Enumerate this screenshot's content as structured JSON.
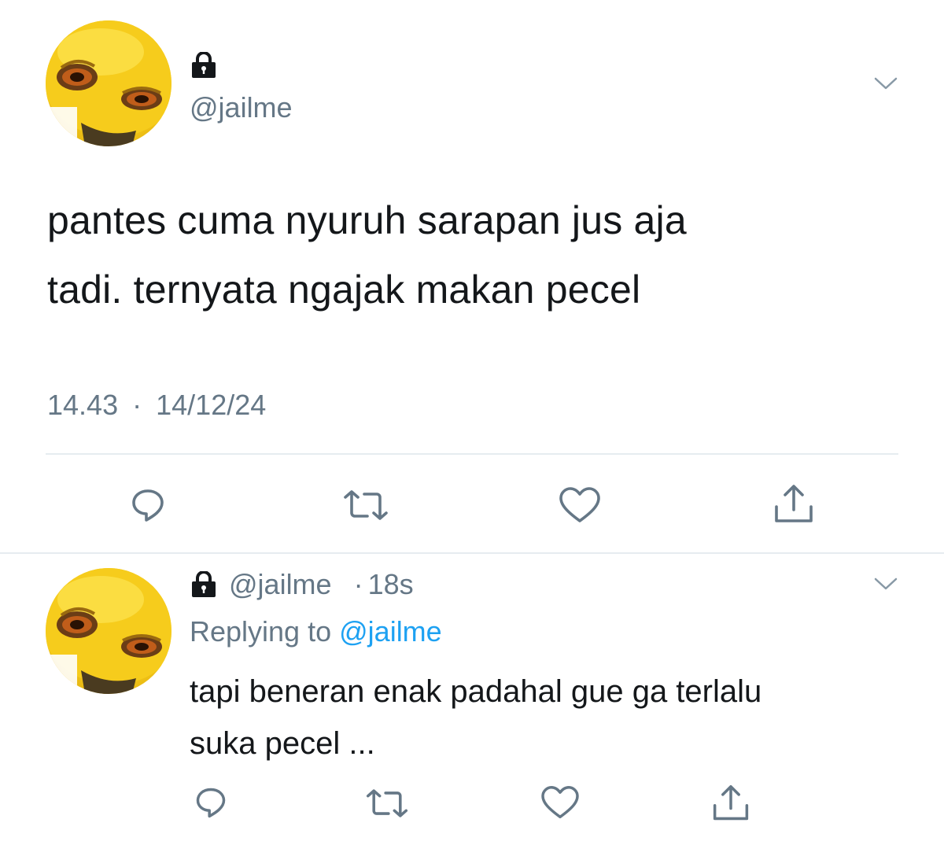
{
  "main_tweet": {
    "handle": "@jailme",
    "text_line1": "pantes cuma nyuruh sarapan jus aja",
    "text_line2": "tadi. ternyata ngajak makan pecel",
    "time": "14.43",
    "separator": "·",
    "date": "14/12/24"
  },
  "reply_tweet": {
    "handle": "@jailme",
    "separator": "·",
    "age": "18s",
    "replying_prefix": "Replying to",
    "replying_mention": "@jailme",
    "text_line1": "tapi beneran enak padahal gue ga terlalu",
    "text_line2": "suka pecel ..."
  },
  "icons": {
    "lock": "lock-icon",
    "chevron": "chevron-down-icon",
    "reply": "reply-icon",
    "retweet": "retweet-icon",
    "like": "heart-icon",
    "share": "share-icon"
  },
  "colors": {
    "text": "#14171a",
    "secondary": "#657786",
    "link": "#1da1f2",
    "avatar": "#f4c718",
    "divider": "#e6ecf0"
  }
}
